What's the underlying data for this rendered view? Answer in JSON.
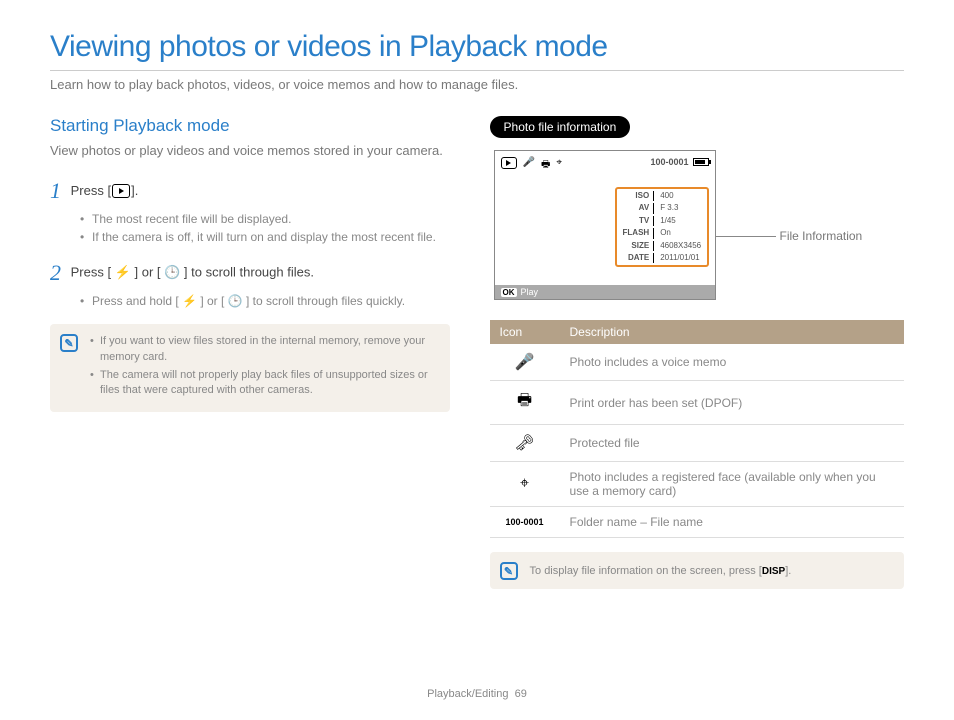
{
  "page": {
    "title": "Viewing photos or videos in Playback mode",
    "subtitle": "Learn how to play back photos, videos, or voice memos and how to manage files.",
    "footer_section": "Playback/Editing",
    "footer_page": "69"
  },
  "left": {
    "heading": "Starting Playback mode",
    "intro": "View photos or play videos and voice memos stored in your camera.",
    "step1": {
      "num": "1",
      "text_pre": "Press [",
      "text_post": "].",
      "bullets": [
        "The most recent file will be displayed.",
        "If the camera is off, it will turn on and display the most recent file."
      ]
    },
    "step2": {
      "num": "2",
      "text": "Press [ ⚡ ] or [ 🕒 ] to scroll through files.",
      "bullet": "Press and hold [ ⚡ ] or [ 🕒 ] to scroll through files quickly."
    },
    "note": [
      "If you want to view files stored in the internal memory, remove your memory card.",
      "The camera will not properly play back files of unsupported sizes or files that were captured with other cameras."
    ]
  },
  "right": {
    "pill": "Photo file information",
    "callout": "File Information",
    "camera": {
      "file_id": "100-0001",
      "ok_label": "Play",
      "info": {
        "ISO": "400",
        "AV": "F 3.3",
        "TV": "1/45",
        "FLASH": "On",
        "SIZE": "4608X3456",
        "DATE": "2011/01/01"
      }
    },
    "table_headers": {
      "icon": "Icon",
      "desc": "Description"
    },
    "rows": [
      {
        "icon": "🎤",
        "desc": "Photo includes a voice memo"
      },
      {
        "icon": "🖶",
        "desc": "Print order has been set (DPOF)"
      },
      {
        "icon": "🗝",
        "desc": "Protected file"
      },
      {
        "icon": "⌖",
        "desc": "Photo includes a registered face (available only when you use a memory card)"
      },
      {
        "icon": "100-0001",
        "desc": "Folder name – File name"
      }
    ],
    "note_pre": "To display file information on the screen, press [",
    "note_disp": "DISP",
    "note_post": "]."
  }
}
